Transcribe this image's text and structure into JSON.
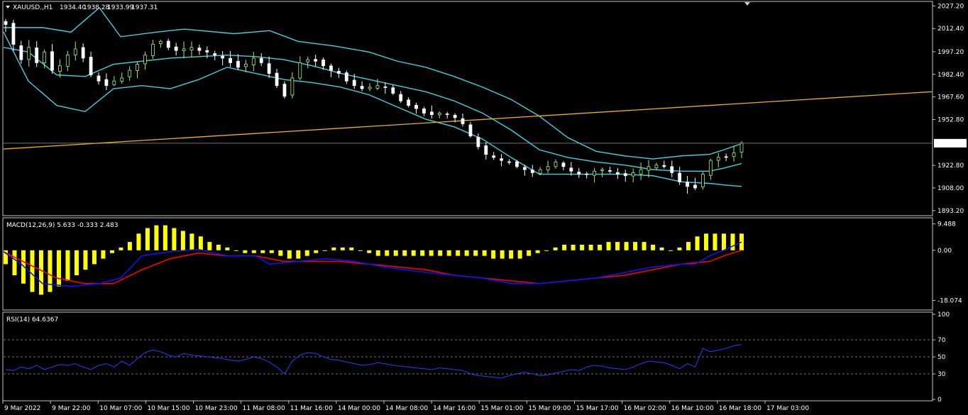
{
  "symbol_header": {
    "symbol": "XAUUSD.,H1",
    "open": "1934.40",
    "high": "1938.28",
    "low": "1933.99",
    "close": "1937.31"
  },
  "macd_header": "MACD(12,26,9) 5.633 -0.333 2.483",
  "rsi_header": "RSI(14) 64.6367",
  "colors": {
    "background": "#000000",
    "frame": "#c8c8c8",
    "bull_candle": "#9ef07a",
    "bear_candle": "#ffffff",
    "bollinger": "#40d0e0",
    "trendline": "#f0b400",
    "histogram": "#ffff00",
    "macd_line": "#1010ff",
    "signal_line": "#ff0000",
    "rsi_line": "#2040ff",
    "price_label_bg": "#ffffff"
  },
  "chart_data": [
    {
      "type": "candlestick",
      "panel": "price",
      "ylim": [
        1890.8,
        2029.2
      ],
      "y_ticks": [
        "2027.20",
        "2012.40",
        "1997.20",
        "1982.40",
        "1967.60",
        "1952.80",
        "1937.31",
        "1922.80",
        "1908.00",
        "1893.20"
      ],
      "current_price": "1937.31",
      "x_ticks": [
        "9 Mar 2022",
        "9 Mar 22:00",
        "10 Mar 07:00",
        "10 Mar 15:00",
        "10 Mar 23:00",
        "11 Mar 08:00",
        "11 Mar 16:00",
        "14 Mar 00:00",
        "14 Mar 08:00",
        "14 Mar 16:00",
        "15 Mar 01:00",
        "15 Mar 09:00",
        "15 Mar 17:00",
        "16 Mar 02:00",
        "16 Mar 10:00",
        "16 Mar 18:00",
        "17 Mar 03:00"
      ],
      "close_path": [
        2015,
        2002,
        1992,
        2000,
        1990,
        1997,
        1985,
        1988,
        1995,
        1999,
        1993,
        1982,
        1978,
        1975,
        1978,
        1980,
        1985,
        1989,
        1995,
        2002,
        2004,
        2000,
        1998,
        1999,
        2000,
        1998,
        1997,
        1995,
        1993,
        1990,
        1987,
        1989,
        1993,
        1990,
        1983,
        1975,
        1968,
        1980,
        1990,
        1992,
        1991,
        1988,
        1985,
        1983,
        1978,
        1975,
        1973,
        1974,
        1975,
        1974,
        1970,
        1965,
        1962,
        1960,
        1957,
        1956,
        1957,
        1956,
        1954,
        1950,
        1942,
        1935,
        1930,
        1928,
        1926,
        1925,
        1922,
        1920,
        1918,
        1920,
        1922,
        1925,
        1922,
        1919,
        1917,
        1917,
        1919,
        1920,
        1919,
        1917,
        1916,
        1918,
        1920,
        1922,
        1923,
        1922,
        1918,
        1912,
        1909,
        1908,
        1917,
        1926,
        1928,
        1928,
        1931,
        1937.31
      ],
      "bollinger": {
        "upper": [
          [
            5,
            2013
          ],
          [
            60,
            2013
          ],
          [
            100,
            2010
          ],
          [
            140,
            2026
          ],
          [
            170,
            2007
          ],
          [
            220,
            2010
          ],
          [
            260,
            2012
          ],
          [
            330,
            2009
          ],
          [
            380,
            2011
          ],
          [
            420,
            2004
          ],
          [
            470,
            2001
          ],
          [
            520,
            1997
          ],
          [
            560,
            1991
          ],
          [
            600,
            1987
          ],
          [
            640,
            1981
          ],
          [
            680,
            1974
          ],
          [
            720,
            1966
          ],
          [
            760,
            1955
          ],
          [
            800,
            1941
          ],
          [
            840,
            1932
          ],
          [
            880,
            1929
          ],
          [
            920,
            1927
          ],
          [
            960,
            1929
          ],
          [
            1000,
            1930
          ],
          [
            1020,
            1933
          ],
          [
            1045,
            1937
          ]
        ],
        "middle": [
          [
            5,
            2000
          ],
          [
            40,
            1997
          ],
          [
            80,
            1982
          ],
          [
            120,
            1981
          ],
          [
            160,
            1989
          ],
          [
            200,
            1991
          ],
          [
            240,
            1993
          ],
          [
            280,
            1994
          ],
          [
            320,
            1995
          ],
          [
            360,
            1994
          ],
          [
            400,
            1992
          ],
          [
            440,
            1988
          ],
          [
            480,
            1983
          ],
          [
            520,
            1979
          ],
          [
            560,
            1975
          ],
          [
            600,
            1971
          ],
          [
            640,
            1965
          ],
          [
            680,
            1957
          ],
          [
            720,
            1946
          ],
          [
            760,
            1933
          ],
          [
            800,
            1928
          ],
          [
            840,
            1925
          ],
          [
            880,
            1923
          ],
          [
            920,
            1920
          ],
          [
            960,
            1919
          ],
          [
            1000,
            1919
          ],
          [
            1020,
            1921
          ],
          [
            1045,
            1924
          ]
        ],
        "lower": [
          [
            5,
            2010
          ],
          [
            40,
            1978
          ],
          [
            80,
            1962
          ],
          [
            120,
            1958
          ],
          [
            160,
            1973
          ],
          [
            200,
            1975
          ],
          [
            240,
            1973
          ],
          [
            280,
            1979
          ],
          [
            320,
            1987
          ],
          [
            360,
            1983
          ],
          [
            400,
            1979
          ],
          [
            440,
            1977
          ],
          [
            480,
            1974
          ],
          [
            520,
            1969
          ],
          [
            560,
            1961
          ],
          [
            600,
            1953
          ],
          [
            640,
            1948
          ],
          [
            680,
            1940
          ],
          [
            720,
            1928
          ],
          [
            760,
            1917
          ],
          [
            800,
            1917
          ],
          [
            840,
            1917
          ],
          [
            880,
            1917
          ],
          [
            920,
            1916
          ],
          [
            960,
            1912
          ],
          [
            1000,
            1911
          ],
          [
            1020,
            1910
          ],
          [
            1045,
            1909
          ]
        ]
      },
      "trendline": [
        [
          5,
          1933.5
        ],
        [
          1313,
          1971
        ]
      ]
    },
    {
      "type": "bar+line",
      "panel": "macd",
      "title": "MACD(12,26,9) 5.633 -0.333 2.483",
      "ylim": [
        -21,
        11.2
      ],
      "y_ticks": [
        "9.488",
        "0.00",
        "-18.074"
      ],
      "histogram": [
        -5,
        -9,
        -12,
        -15,
        -16,
        -15,
        -13,
        -11,
        -9,
        -7,
        -5,
        -3,
        -1,
        1,
        3,
        6,
        8,
        9,
        9,
        8,
        7,
        6,
        5,
        3,
        2,
        1,
        0,
        -1,
        -1,
        -1,
        -1,
        -2,
        -3,
        -3,
        -2,
        -1,
        0,
        1,
        1,
        1,
        0,
        -1,
        -2,
        -2,
        -2,
        -2,
        -2,
        -2,
        -2,
        -2,
        -2,
        -2,
        -2,
        -2,
        -2,
        -3,
        -3,
        -3,
        -3,
        -2,
        -1,
        0,
        1,
        2,
        2,
        2,
        2,
        2,
        3,
        3,
        3,
        3,
        3,
        2,
        1,
        0,
        1,
        3,
        5,
        6,
        6,
        6,
        6,
        6
      ],
      "macd_line": [
        [
          5,
          -0.5
        ],
        [
          30,
          -5
        ],
        [
          60,
          -12
        ],
        [
          100,
          -13
        ],
        [
          140,
          -12
        ],
        [
          170,
          -10
        ],
        [
          200,
          -2
        ],
        [
          240,
          -0.5
        ],
        [
          280,
          0.3
        ],
        [
          320,
          -2
        ],
        [
          360,
          -2
        ],
        [
          380,
          -5
        ],
        [
          420,
          -4
        ],
        [
          460,
          -3
        ],
        [
          500,
          -4
        ],
        [
          540,
          -6
        ],
        [
          600,
          -8
        ],
        [
          640,
          -9
        ],
        [
          680,
          -10
        ],
        [
          720,
          -12
        ],
        [
          760,
          -12
        ],
        [
          800,
          -11
        ],
        [
          840,
          -10
        ],
        [
          880,
          -8
        ],
        [
          920,
          -6
        ],
        [
          960,
          -5
        ],
        [
          980,
          -5
        ],
        [
          1000,
          -2
        ],
        [
          1020,
          0
        ],
        [
          1045,
          3
        ]
      ],
      "signal_line": [
        [
          5,
          -0.5
        ],
        [
          40,
          -5
        ],
        [
          80,
          -10
        ],
        [
          120,
          -12
        ],
        [
          160,
          -12
        ],
        [
          200,
          -7
        ],
        [
          240,
          -3
        ],
        [
          280,
          -1
        ],
        [
          320,
          -2
        ],
        [
          360,
          -2
        ],
        [
          400,
          -4
        ],
        [
          440,
          -4
        ],
        [
          480,
          -4
        ],
        [
          520,
          -5
        ],
        [
          560,
          -6
        ],
        [
          600,
          -7
        ],
        [
          640,
          -9
        ],
        [
          680,
          -10
        ],
        [
          720,
          -11
        ],
        [
          760,
          -12
        ],
        [
          800,
          -11
        ],
        [
          840,
          -10
        ],
        [
          880,
          -9
        ],
        [
          920,
          -7
        ],
        [
          960,
          -5
        ],
        [
          1000,
          -4
        ],
        [
          1020,
          -2
        ],
        [
          1045,
          0
        ]
      ]
    },
    {
      "type": "line",
      "panel": "rsi",
      "title": "RSI(14) 64.6367",
      "ylim": [
        0,
        100
      ],
      "y_ticks": [
        "100",
        "70",
        "50",
        "30",
        "0"
      ],
      "levels": [
        70,
        50,
        30
      ],
      "values": [
        35,
        34,
        38,
        36,
        40,
        35,
        38,
        41,
        40,
        42,
        38,
        35,
        40,
        42,
        38,
        45,
        40,
        48,
        55,
        58,
        56,
        52,
        50,
        54,
        52,
        51,
        50,
        49,
        48,
        46,
        45,
        47,
        50,
        48,
        44,
        38,
        30,
        45,
        52,
        55,
        54,
        50,
        47,
        46,
        44,
        42,
        40,
        41,
        43,
        42,
        40,
        39,
        38,
        37,
        36,
        35,
        37,
        36,
        35,
        34,
        30,
        28,
        27,
        26,
        25,
        28,
        30,
        32,
        30,
        28,
        29,
        31,
        33,
        35,
        34,
        38,
        40,
        39,
        37,
        36,
        35,
        38,
        42,
        45,
        44,
        43,
        40,
        36,
        42,
        38,
        60,
        56,
        58,
        60,
        63,
        64.6
      ]
    }
  ]
}
